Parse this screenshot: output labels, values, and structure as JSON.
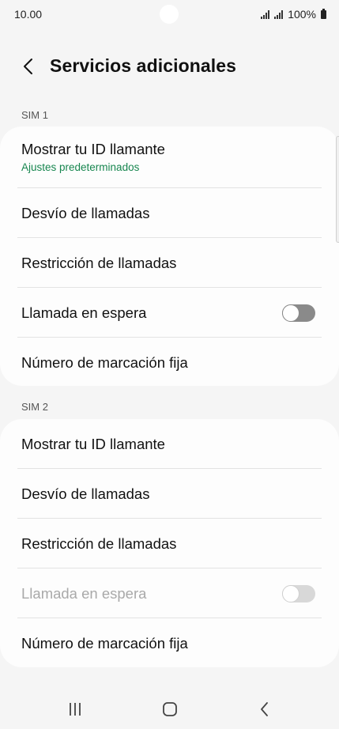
{
  "status_bar": {
    "time": "10.00",
    "battery": "100%"
  },
  "header": {
    "title": "Servicios adicionales"
  },
  "sim1": {
    "label": "SIM 1",
    "items": [
      {
        "label": "Mostrar tu ID llamante",
        "sublabel": "Ajustes predeterminados"
      },
      {
        "label": "Desvío de llamadas"
      },
      {
        "label": "Restricción de llamadas"
      },
      {
        "label": "Llamada en espera",
        "toggle": false
      },
      {
        "label": "Número de marcación fija"
      }
    ]
  },
  "sim2": {
    "label": "SIM 2",
    "items": [
      {
        "label": "Mostrar tu ID llamante"
      },
      {
        "label": "Desvío de llamadas"
      },
      {
        "label": "Restricción de llamadas"
      },
      {
        "label": "Llamada en espera",
        "toggle": false,
        "disabled": true
      },
      {
        "label": "Número de marcación fija"
      }
    ]
  },
  "colors": {
    "background": "#f5f5f5",
    "card": "#fdfdfd",
    "accent_green": "#17864f",
    "disabled_text": "#a9a9a9"
  },
  "icons": {
    "back": "chevron-left-icon",
    "signal": "signal-bars-icon",
    "battery": "battery-icon",
    "nav_recents": "recent-apps-icon",
    "nav_home": "home-icon",
    "nav_back": "back-icon"
  }
}
